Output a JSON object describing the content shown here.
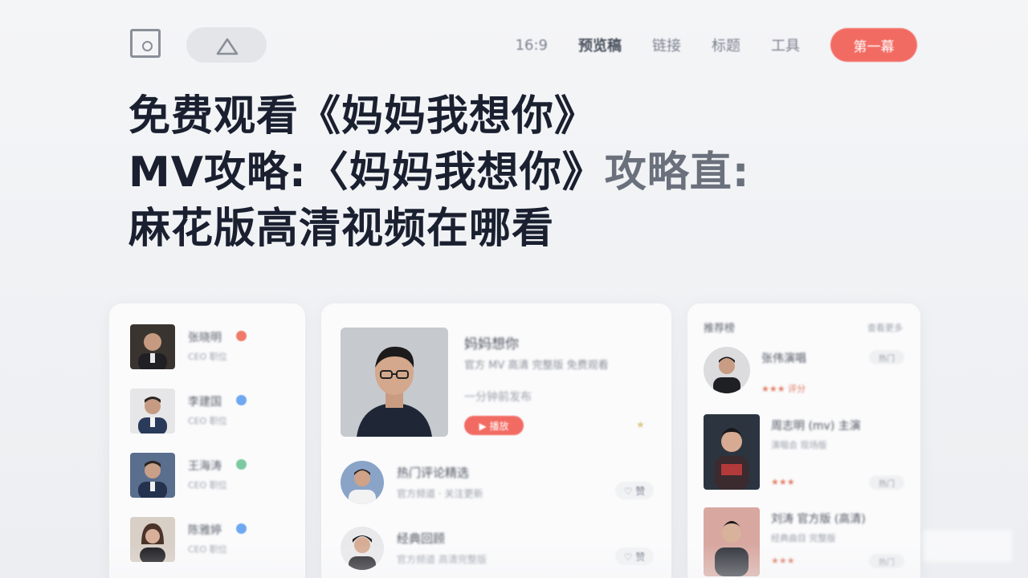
{
  "header": {
    "nav_items": [
      "16:9",
      "预览稿",
      "链接",
      "标题",
      "工具"
    ],
    "cta_label": "第一幕"
  },
  "headline": {
    "line1": "免费观看《妈妈我想你》",
    "line2_a": "MV攻略:〈妈妈我想你》",
    "line2_b": "攻略直:",
    "line3": "麻花版高清视频在哪看"
  },
  "left_list": [
    {
      "name": "张晓明",
      "sub": "CEO 职位",
      "badge_color": "#f07a6a"
    },
    {
      "name": "李建国",
      "sub": "CEO 职位",
      "badge_color": "#6ea8f0"
    },
    {
      "name": "王海涛",
      "sub": "CEO 职位",
      "badge_color": "#7cc9a0"
    },
    {
      "name": "陈雅婷",
      "sub": "CEO 职位",
      "badge_color": "#6ea8f0"
    }
  ],
  "feature": {
    "title": "妈妈想你",
    "desc": "官方 MV 高清 完整版 免费观看",
    "meta": "一分钟前发布",
    "button": "▶ 播放",
    "star": "★"
  },
  "mid_list": [
    {
      "title": "热门评论精选",
      "sub": "官方频道 · 关注更新",
      "likes": "♡ 赞"
    },
    {
      "title": "经典回顾",
      "sub": "官方频道 高清完整版",
      "likes": "♡ 赞"
    }
  ],
  "right_panel": {
    "header": "推荐榜",
    "more": "查看更多",
    "items": [
      {
        "name": "张伟演唱",
        "sub": "",
        "rating": "★★★ 评分",
        "tag": "热门"
      },
      {
        "name": "周志明 (mv) 主演",
        "sub": "演唱会 现场版",
        "rating": "★★★",
        "tag": "热门"
      },
      {
        "name": "刘涛 官方版 (高清)",
        "sub": "经典曲目 完整版",
        "rating": "★★★",
        "tag": "热门"
      }
    ]
  },
  "colors": {
    "accent": "#f26b63",
    "title_text": "#1a2030",
    "muted_text": "#6a707c"
  }
}
